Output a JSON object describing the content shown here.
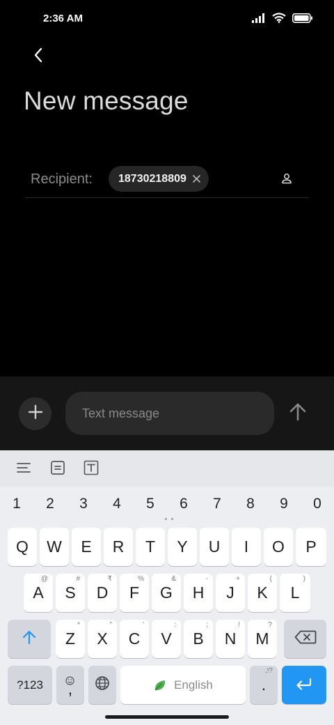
{
  "status_bar": {
    "time": "2:36 AM"
  },
  "header": {
    "title": "New message"
  },
  "recipient": {
    "label": "Recipient:",
    "chip_number": "18730218809"
  },
  "compose": {
    "placeholder": "Text message"
  },
  "keyboard": {
    "numbers": [
      "1",
      "2",
      "3",
      "4",
      "5",
      "6",
      "7",
      "8",
      "9",
      "0"
    ],
    "row1": [
      "Q",
      "W",
      "E",
      "R",
      "T",
      "Y",
      "U",
      "I",
      "O",
      "P"
    ],
    "row2": [
      "A",
      "S",
      "D",
      "F",
      "G",
      "H",
      "J",
      "K",
      "L"
    ],
    "row2_hints": [
      "@",
      "#",
      "₹",
      "%",
      "&",
      "-",
      "+",
      "(",
      ")"
    ],
    "row3": [
      "Z",
      "X",
      "C",
      "V",
      "B",
      "N",
      "M"
    ],
    "row3_hints": [
      "*",
      "\"",
      "'",
      ":",
      ";",
      "!",
      "?"
    ],
    "symbols_key": "?123",
    "comma_key": ",",
    "space_label": "English",
    "period_key": ".",
    "period_hint": ",!?"
  },
  "colors": {
    "accent": "#2196f3",
    "background": "#000000",
    "keyboard_bg": "#eceef1"
  }
}
